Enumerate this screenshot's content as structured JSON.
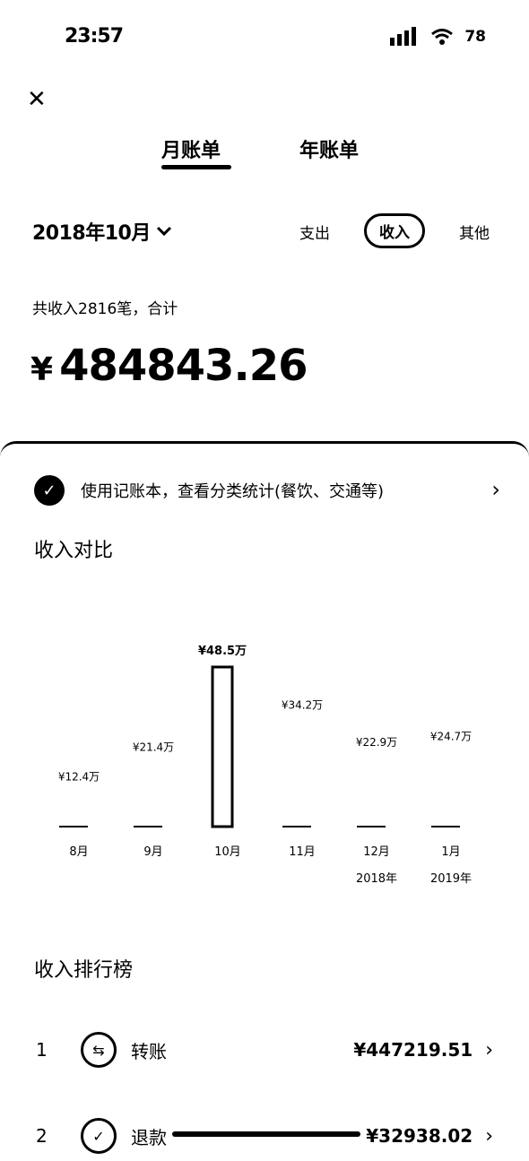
{
  "status": {
    "time": "23:57",
    "battery": "78"
  },
  "tabs": {
    "monthly": "月账单",
    "yearly": "年账单"
  },
  "filters": {
    "month": "2018年10月",
    "expense": "支出",
    "income": "收入",
    "other": "其他"
  },
  "summary": {
    "text": "共收入2816笔，合计",
    "total_symbol": "¥",
    "total": "484843.26"
  },
  "promo": {
    "text": "使用记账本，查看分类统计(餐饮、交通等)"
  },
  "sections": {
    "compare": "收入对比",
    "ranking": "收入排行榜"
  },
  "chart_data": {
    "type": "bar",
    "categories": [
      "8月",
      "9月",
      "10月",
      "11月",
      "12月",
      "1月"
    ],
    "year_labels": [
      "",
      "",
      "",
      "",
      "2018年",
      "2019年"
    ],
    "values": [
      12.4,
      21.4,
      48.5,
      34.2,
      22.9,
      24.7
    ],
    "value_labels": [
      "¥12.4万",
      "¥21.4万",
      "¥48.5万",
      "¥34.2万",
      "¥22.9万",
      "¥24.7万"
    ],
    "highlight_index": 2,
    "unit": "万"
  },
  "ranking": [
    {
      "rank": "1",
      "icon": "transfer-icon",
      "label": "转账",
      "amount": "¥447219.51"
    },
    {
      "rank": "2",
      "icon": "refund-check-icon",
      "label": "退款",
      "amount": "¥32938.02"
    }
  ]
}
